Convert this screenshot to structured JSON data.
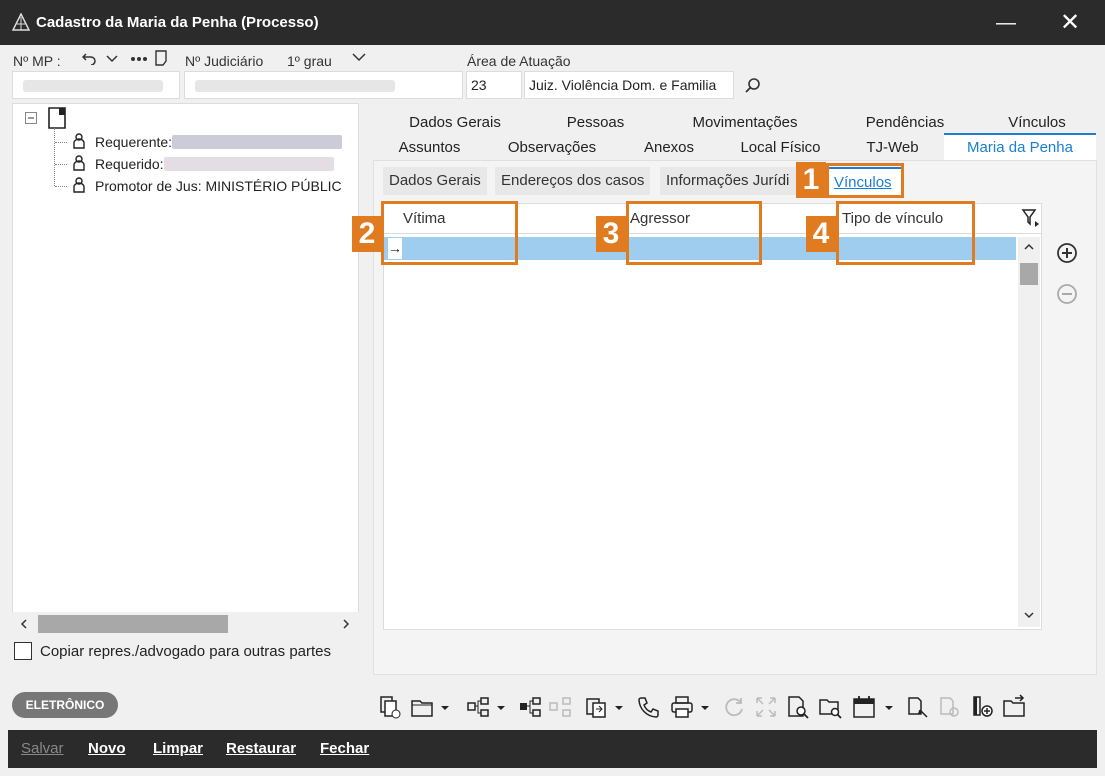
{
  "window": {
    "title": "Cadastro da Maria da Penha (Processo)",
    "minimize": "—",
    "close": "✕"
  },
  "header": {
    "mp_label": "Nº MP :",
    "judiciario_label": "Nº Judiciário",
    "grau_label": "1º grau",
    "area_label": "Área de Atuação",
    "area_code": "23",
    "area_name": "Juiz. Violência Dom. e Familia"
  },
  "tree": {
    "items": [
      {
        "label": "Requerente:"
      },
      {
        "label": "Requerido:"
      },
      {
        "label": "Promotor de Jus: MINISTÉRIO PÚBLIC"
      }
    ]
  },
  "copy_checkbox_label": "Copiar repres./advogado para outras partes",
  "tabs_row1": [
    "Dados Gerais",
    "Pessoas",
    "Movimentações",
    "Pendências",
    "Vínculos"
  ],
  "tabs_row2": [
    "Assuntos",
    "Observações",
    "Anexos",
    "Local Físico",
    "TJ-Web",
    "Maria da Penha"
  ],
  "subtabs": [
    "Dados Gerais",
    "Endereços dos casos",
    "Informações Jurídi",
    "Vínculos"
  ],
  "grid": {
    "columns": [
      "Vítima",
      "Agressor",
      "Tipo de vínculo"
    ],
    "row_marker": "→"
  },
  "callouts": [
    "1",
    "2",
    "3",
    "4"
  ],
  "badge": "ELETRÔNICO",
  "bottom_buttons": {
    "salvar": "Salvar",
    "novo": "Novo",
    "limpar": "Limpar",
    "restaurar": "Restaurar",
    "fechar": "Fechar"
  },
  "colors": {
    "titlebar": "#2b2b2b",
    "accent": "#1a7fd4",
    "callout": "#e07b20",
    "selected_row": "#9fcdf0"
  }
}
